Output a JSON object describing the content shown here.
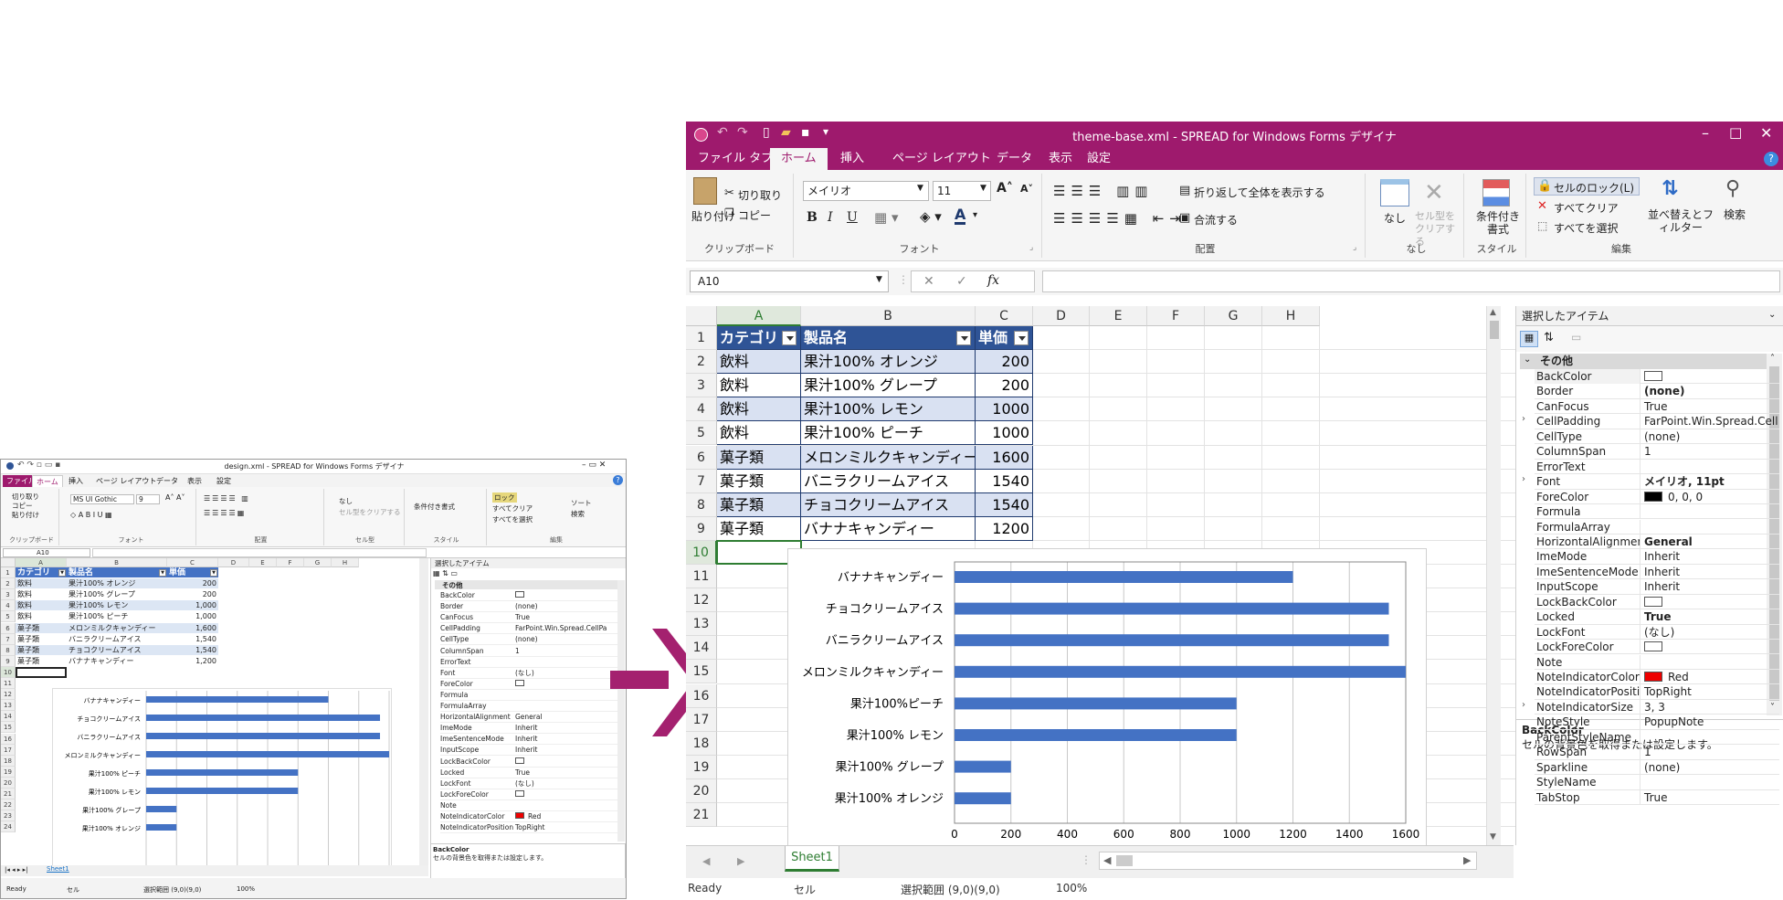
{
  "small": {
    "title": "design.xml - SPREAD for Windows Forms デザイナ",
    "tabs": [
      "ファイル",
      "ホーム",
      "挿入",
      "ページ レイアウト",
      "データ",
      "表示",
      "設定"
    ],
    "clipboard": {
      "cut": "切り取り",
      "copy": "コピー",
      "paste": "貼り付け",
      "label": "クリップボード"
    },
    "font": {
      "name": "MS UI Gothic",
      "size": "9",
      "label": "フォント"
    },
    "align_label": "配置",
    "celltype": {
      "none": "なし",
      "clear": "セル型をクリアする",
      "label": "セル型"
    },
    "style": {
      "cond": "条件付き書式",
      "label": "スタイル"
    },
    "edit": {
      "lock": "ロック",
      "clear_all": "すべてクリア",
      "select_all": "すべてを選択",
      "sort": "ソート",
      "search": "検索",
      "label": "編集"
    },
    "name_box": "A10",
    "columns": [
      "A",
      "B",
      "C",
      "D",
      "E",
      "F",
      "G",
      "H"
    ],
    "rows": [
      "1",
      "2",
      "3",
      "4",
      "5",
      "6",
      "7",
      "8",
      "9",
      "10",
      "11",
      "12",
      "13",
      "14",
      "15",
      "16",
      "17",
      "18",
      "19",
      "20",
      "21",
      "22",
      "23",
      "24"
    ],
    "table_header": [
      "カテゴリ",
      "製品名",
      "単価"
    ],
    "table_rows": [
      [
        "飲料",
        "果汁100% オレンジ",
        "200"
      ],
      [
        "飲料",
        "果汁100% グレープ",
        "200"
      ],
      [
        "飲料",
        "果汁100% レモン",
        "1,000"
      ],
      [
        "飲料",
        "果汁100% ピーチ",
        "1,000"
      ],
      [
        "菓子類",
        "メロンミルクキャンディー",
        "1,600"
      ],
      [
        "菓子類",
        "バニラクリームアイス",
        "1,540"
      ],
      [
        "菓子類",
        "チョコクリームアイス",
        "1,540"
      ],
      [
        "菓子類",
        "バナナキャンディー",
        "1,200"
      ]
    ],
    "chart_labels": [
      "バナナキャンディー",
      "チョコクリームアイス",
      "バニラクリームアイス",
      "メロンミルクキャンディー",
      "果汁100% ピーチ",
      "果汁100% レモン",
      "果汁100% グレープ",
      "果汁100% オレンジ"
    ],
    "props_header": "選択したアイテム",
    "props_category": "その他",
    "props": [
      [
        "BackColor",
        ""
      ],
      [
        "Border",
        "(none)"
      ],
      [
        "CanFocus",
        "True"
      ],
      [
        "CellPadding",
        "FarPoint.Win.Spread.CellPa"
      ],
      [
        "CellType",
        "(none)"
      ],
      [
        "ColumnSpan",
        "1"
      ],
      [
        "ErrorText",
        ""
      ],
      [
        "Font",
        "(なし)"
      ],
      [
        "ForeColor",
        ""
      ],
      [
        "Formula",
        ""
      ],
      [
        "FormulaArray",
        ""
      ],
      [
        "HorizontalAlignment",
        "General"
      ],
      [
        "ImeMode",
        "Inherit"
      ],
      [
        "ImeSentenceMode",
        "Inherit"
      ],
      [
        "InputScope",
        "Inherit"
      ],
      [
        "LockBackColor",
        ""
      ],
      [
        "Locked",
        "True"
      ],
      [
        "LockFont",
        "(なし)"
      ],
      [
        "LockForeColor",
        ""
      ],
      [
        "Note",
        ""
      ],
      [
        "NoteIndicatorColor",
        "Red"
      ],
      [
        "NoteIndicatorPosition",
        "TopRight"
      ]
    ],
    "desc_title": "BackColor",
    "desc_text": "セルの背景色を取得または設定します。",
    "sheet_tab": "Sheet1",
    "status": {
      "ready": "Ready",
      "cell": "セル",
      "range": "選択範囲 (9,0)(9,0)",
      "zoom": "100%"
    }
  },
  "big": {
    "title": "theme-base.xml - SPREAD for Windows Forms デザイナ",
    "tabs": [
      "ファイル タブ",
      "ホーム",
      "挿入",
      "ページ レイアウト",
      "データ",
      "表示",
      "設定"
    ],
    "clipboard": {
      "paste": "貼り付け",
      "cut": "切り取り",
      "copy": "コピー",
      "label": "クリップボード"
    },
    "font": {
      "name": "メイリオ",
      "size": "11",
      "label": "フォント"
    },
    "align": {
      "wrap": "折り返して全体を表示する",
      "merge": "合流する",
      "label": "配置"
    },
    "celltype": {
      "none": "なし",
      "clear": "セル型をクリアする",
      "label": "なし"
    },
    "style": {
      "cond": "条件付き書式",
      "label": "スタイル"
    },
    "edit": {
      "lock": "セルのロック(L)",
      "clear_all": "すべてクリア",
      "select_all": "すべてを選択",
      "sort": "並べ替えとフィルター",
      "search": "検索",
      "label": "編集"
    },
    "name_box": "A10",
    "columns": [
      "A",
      "B",
      "C",
      "D",
      "E",
      "F",
      "G",
      "H"
    ],
    "rows": [
      "1",
      "2",
      "3",
      "4",
      "5",
      "6",
      "7",
      "8",
      "9",
      "10",
      "11",
      "12",
      "13",
      "14",
      "15",
      "16",
      "17",
      "18",
      "19",
      "20",
      "21"
    ],
    "table_header": [
      "カテゴリ",
      "製品名",
      "単価"
    ],
    "table_rows": [
      [
        "飲料",
        "果汁100% オレンジ",
        "200"
      ],
      [
        "飲料",
        "果汁100% グレープ",
        "200"
      ],
      [
        "飲料",
        "果汁100% レモン",
        "1000"
      ],
      [
        "飲料",
        "果汁100% ピーチ",
        "1000"
      ],
      [
        "菓子類",
        "メロンミルクキャンディー",
        "1600"
      ],
      [
        "菓子類",
        "バニラクリームアイス",
        "1540"
      ],
      [
        "菓子類",
        "チョコクリームアイス",
        "1540"
      ],
      [
        "菓子類",
        "バナナキャンディー",
        "1200"
      ]
    ],
    "props_header": "選択したアイテム",
    "props_category": "その他",
    "props": [
      [
        "BackColor",
        ""
      ],
      [
        "Border",
        "(none)"
      ],
      [
        "CanFocus",
        "True"
      ],
      [
        "CellPadding",
        "FarPoint.Win.Spread.CellP"
      ],
      [
        "CellType",
        "(none)"
      ],
      [
        "ColumnSpan",
        "1"
      ],
      [
        "ErrorText",
        ""
      ],
      [
        "Font",
        "メイリオ, 11pt"
      ],
      [
        "ForeColor",
        "0, 0, 0"
      ],
      [
        "Formula",
        ""
      ],
      [
        "FormulaArray",
        ""
      ],
      [
        "HorizontalAlignment",
        "General"
      ],
      [
        "ImeMode",
        "Inherit"
      ],
      [
        "ImeSentenceMode",
        "Inherit"
      ],
      [
        "InputScope",
        "Inherit"
      ],
      [
        "LockBackColor",
        ""
      ],
      [
        "Locked",
        "True"
      ],
      [
        "LockFont",
        "(なし)"
      ],
      [
        "LockForeColor",
        ""
      ],
      [
        "Note",
        ""
      ],
      [
        "NoteIndicatorColor",
        "Red"
      ],
      [
        "NoteIndicatorPositio",
        "TopRight"
      ],
      [
        "NoteIndicatorSize",
        "3, 3"
      ],
      [
        "NoteStyle",
        "PopupNote"
      ],
      [
        "ParentStyleName",
        ""
      ],
      [
        "RowSpan",
        "1"
      ],
      [
        "Sparkline",
        "(none)"
      ],
      [
        "StyleName",
        ""
      ],
      [
        "TabStop",
        "True"
      ]
    ],
    "desc_title": "BackColor",
    "desc_text": "セルの背景色を取得または設定します。",
    "sheet_tab": "Sheet1",
    "status": {
      "ready": "Ready",
      "cell": "セル",
      "range": "選択範囲 (9,0)(9,0)",
      "zoom": "100%"
    }
  },
  "colors": {
    "accent": "#9e1a6d",
    "header": "#2f5496",
    "band": "#d9e1f2",
    "bar": "#4472c4",
    "small_header": "#4472c4",
    "small_band": "#dce6f4"
  },
  "chart_data": [
    {
      "type": "bar",
      "orientation": "horizontal",
      "categories": [
        "バナナキャンディー",
        "チョコクリームアイス",
        "バニラクリームアイス",
        "メロンミルクキャンディー",
        "果汁100%ピーチ",
        "果汁100% レモン",
        "果汁100% グレープ",
        "果汁100% オレンジ"
      ],
      "values": [
        1200,
        1540,
        1540,
        1600,
        1000,
        1000,
        200,
        200
      ],
      "xticks": [
        "0",
        "200",
        "400",
        "600",
        "800",
        "1000",
        "1200",
        "1400",
        "1600"
      ],
      "xlim": [
        0,
        1600
      ],
      "grid": true
    }
  ]
}
